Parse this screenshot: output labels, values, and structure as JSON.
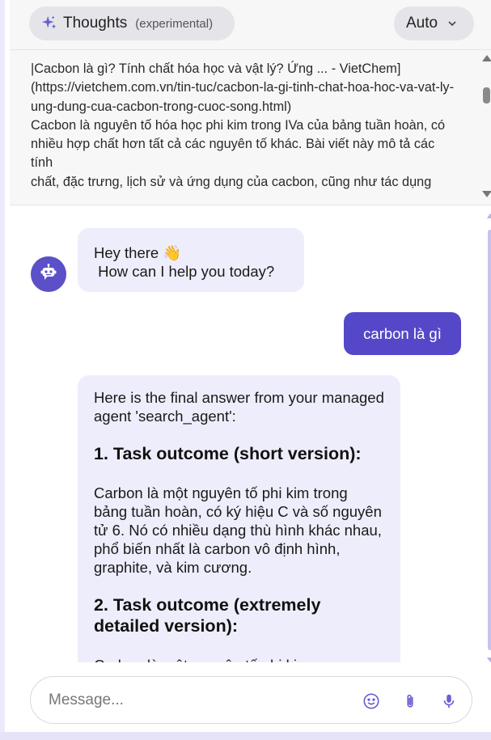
{
  "header": {
    "thoughts_label": "Thoughts",
    "thoughts_tag": "(experimental)",
    "mode_label": "Auto"
  },
  "thoughts_panel": {
    "text": "|Cacbon là gì? Tính chất hóa học và vật lý? Ứng ... - VietChem](https://vietchem.com.vn/tin-tuc/cacbon-la-gi-tinh-chat-hoa-hoc-va-vat-ly-ung-dung-cua-cacbon-trong-cuoc-song.html)\nCacbon là nguyên tố hóa học phi kim trong IVa của bảng tuần hoàn, có nhiều hợp chất hơn tất cả các nguyên tố khác. Bài viết này mô tả các tính\nchất, đặc trưng, lịch sử và ứng dụng của cacbon, cũng như tác dụng"
  },
  "chat": {
    "greeting": "Hey there 👋\n How can I help you today?",
    "user_message": "carbon là gì",
    "answer": {
      "intro": "Here is the final answer from your managed agent 'search_agent':",
      "heading1": "1. Task outcome (short version):",
      "short": "Carbon là một nguyên tố phi kim trong bảng tuần hoàn, có ký hiệu C và số nguyên tử 6. Nó có nhiều dạng thù hình khác nhau, phổ biến nhất là carbon vô định hình, graphite, và kim cương.",
      "heading2": "2. Task outcome (extremely detailed version):",
      "cut_line": "Carbon là một nguyên tố phi kim"
    }
  },
  "composer": {
    "placeholder": "Message..."
  },
  "colors": {
    "accent": "#5448c8",
    "bot_bubble": "#eeedfb",
    "panel_bg": "#f7f7f8"
  },
  "icons": [
    "sparkle-icon",
    "chevron-down-icon",
    "robot-icon",
    "emoji-icon",
    "paperclip-icon",
    "microphone-icon"
  ]
}
